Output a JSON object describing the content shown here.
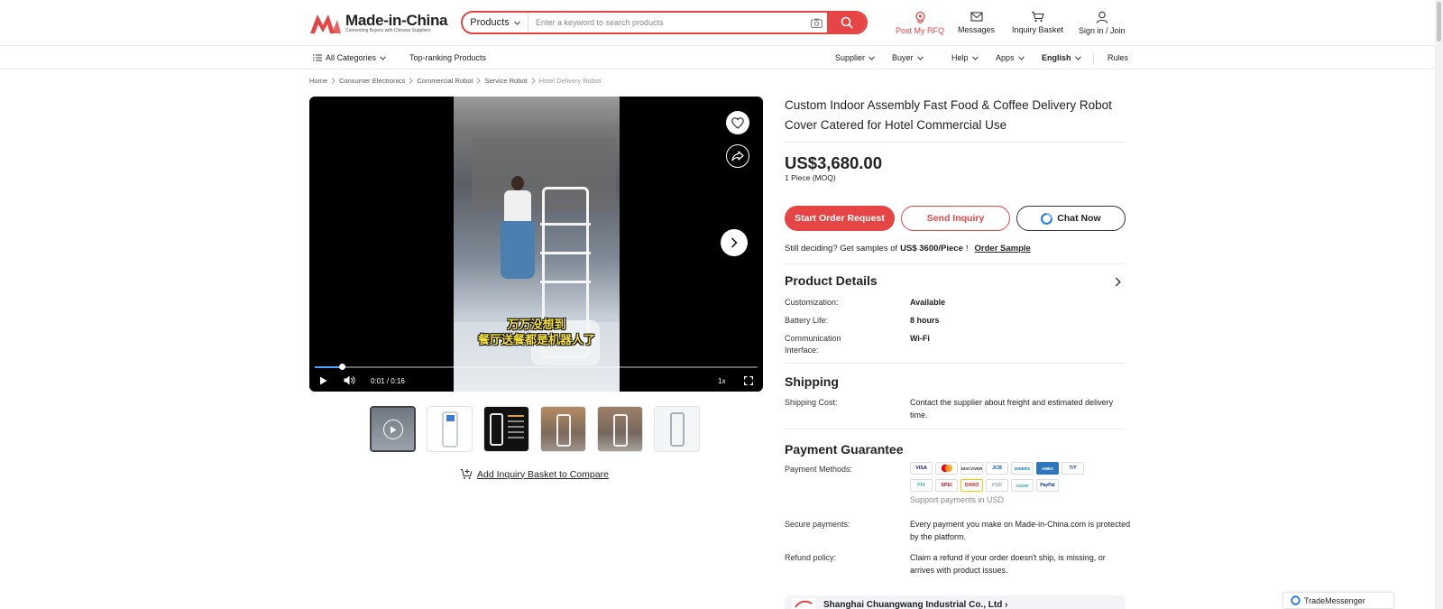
{
  "brand": {
    "name": "Made-in-China",
    "tagline": "Connecting Buyers with Chinese Suppliers",
    "red": "#e64545"
  },
  "search": {
    "category": "Products",
    "placeholder": "Enter a keyword to search products"
  },
  "header_nav": {
    "rfq": "Post My RFQ",
    "messages": "Messages",
    "basket": "Inquiry Basket",
    "signin": "Sign in / Join"
  },
  "category_nav": {
    "all": "All Categories",
    "top": "Top-ranking Products",
    "supplier": "Supplier",
    "buyer": "Buyer",
    "help": "Help",
    "apps": "Apps",
    "language": "English",
    "rules": "Rules"
  },
  "breadcrumb": [
    "Home",
    "Consumer Electronics",
    "Commercial Robot",
    "Service Robot",
    "Hotel Delivery Robot"
  ],
  "video": {
    "subtitle_line1": "万万没想到",
    "subtitle_line2": "餐厅送餐都是机器人了",
    "time": "0:01 / 0:16",
    "speed": "1x",
    "progress": 0.0625
  },
  "compare_link": "Add Inquiry Basket to Compare",
  "product": {
    "title": "Custom Indoor Assembly Fast Food & Coffee Delivery Robot Cover Catered for Hotel Commercial Use",
    "price": "US$3,680.00",
    "moq": "1 Piece (MOQ)",
    "btn_order": "Start Order Request",
    "btn_inquiry": "Send Inquiry",
    "btn_chat": "Chat Now",
    "sample_prefix": "Still deciding? Get samples of",
    "sample_price": "US$ 3600/Piece",
    "sample_suffix": "!",
    "sample_link": "Order Sample"
  },
  "details": {
    "heading": "Product Details",
    "rows": [
      {
        "label": "Customization:",
        "value": "Available"
      },
      {
        "label": "Battery Life:",
        "value": "8 hours"
      },
      {
        "label": "Communication Interface:",
        "value": "Wi-Fi"
      }
    ]
  },
  "shipping": {
    "heading": "Shipping",
    "label": "Shipping Cost:",
    "value": "Contact the supplier about freight and estimated delivery time."
  },
  "payment": {
    "heading": "Payment Guarantee",
    "methods_label": "Payment Methods:",
    "methods_row1": [
      "VISA",
      "MC",
      "DISCOVER",
      "JCB",
      "DINERS",
      "AMEX",
      "T/T"
    ],
    "methods_row2": [
      "PIX",
      "SPEI",
      "OXXO",
      "PSE",
      "OZOW",
      "PayPal"
    ],
    "currency_note": "Support payments in USD",
    "secure_label": "Secure payments:",
    "secure_value": "Every payment you make on Made-in-China.com is protected by the platform.",
    "refund_label": "Refund policy:",
    "refund_value": "Claim a refund if your order doesn't ship, is missing, or arrives with product issues."
  },
  "supplier": {
    "name": "Shanghai Chuangwang Industrial Co., Ltd"
  },
  "trademessenger": "TradeMessenger"
}
